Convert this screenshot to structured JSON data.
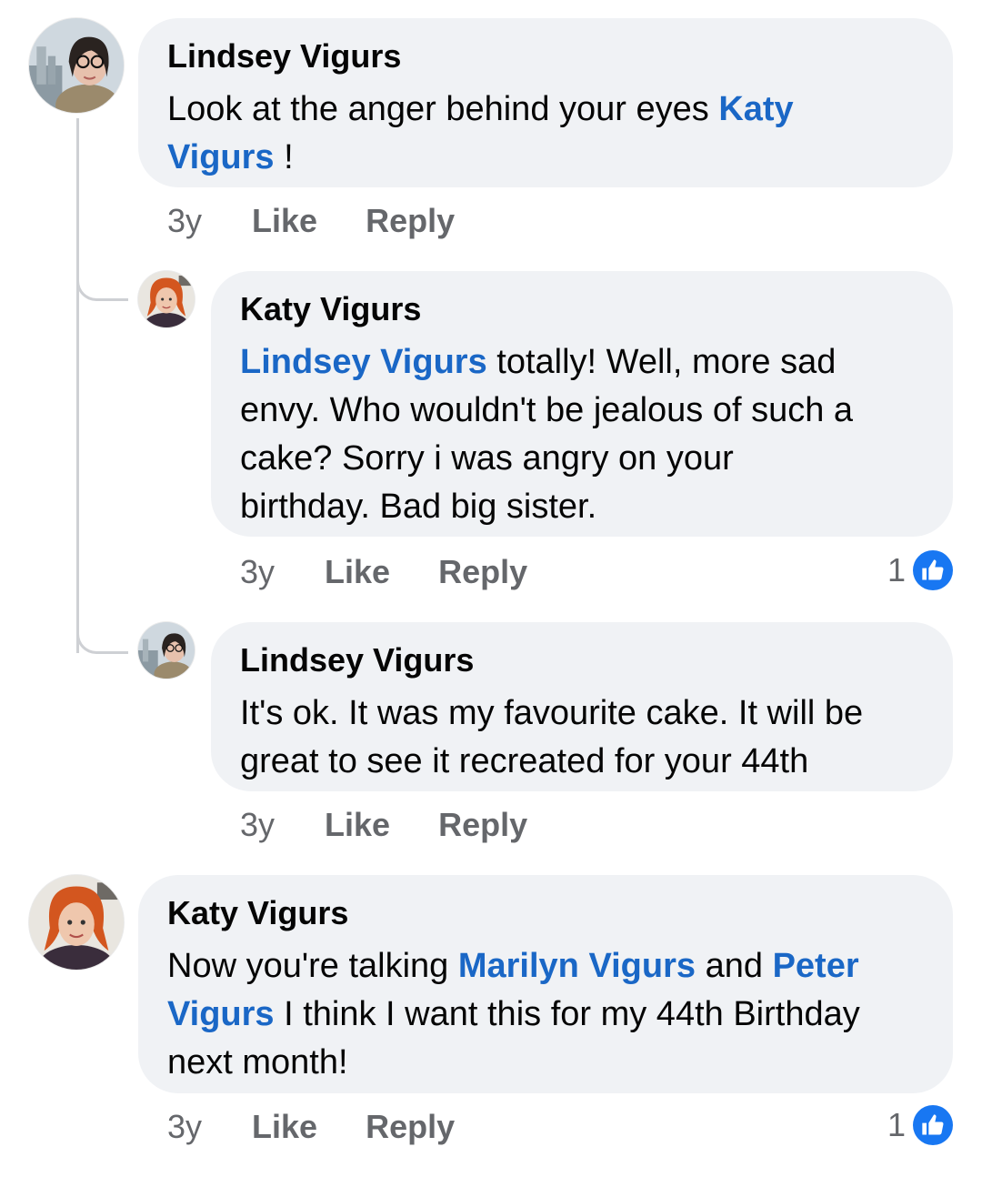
{
  "comments": [
    {
      "author": "Lindsey Vigurs",
      "text_parts": [
        "Look at the anger behind your eyes ",
        "Katy",
        "Vigurs",
        " !"
      ],
      "time": "3y",
      "like_label": "Like",
      "reply_label": "Reply"
    },
    {
      "author": "Katy Vigurs",
      "text_parts": [
        "Lindsey Vigurs",
        " totally! Well, more sad",
        "envy. Who wouldn't be jealous of such a",
        "cake? Sorry i was angry on your",
        "birthday. Bad big sister."
      ],
      "time": "3y",
      "like_label": "Like",
      "reply_label": "Reply",
      "reaction_count": "1"
    },
    {
      "author": "Lindsey Vigurs",
      "text_parts": [
        "It's ok. It was my favourite cake. It will be",
        "great to see it recreated for your 44th"
      ],
      "time": "3y",
      "like_label": "Like",
      "reply_label": "Reply"
    },
    {
      "author": "Katy Vigurs",
      "text_parts": [
        "Now you're talking ",
        "Marilyn Vigurs",
        " and ",
        "Peter",
        "Vigurs",
        " I think I want this for my 44th Birthday",
        "next month!"
      ],
      "time": "3y",
      "like_label": "Like",
      "reply_label": "Reply",
      "reaction_count": "1"
    }
  ],
  "colors": {
    "mention": "#1a67c6",
    "bubble": "#f0f2f5",
    "like_badge": "#1877f2",
    "meta_text": "#65676b"
  },
  "icons": {
    "reaction": "like-thumb-icon"
  }
}
